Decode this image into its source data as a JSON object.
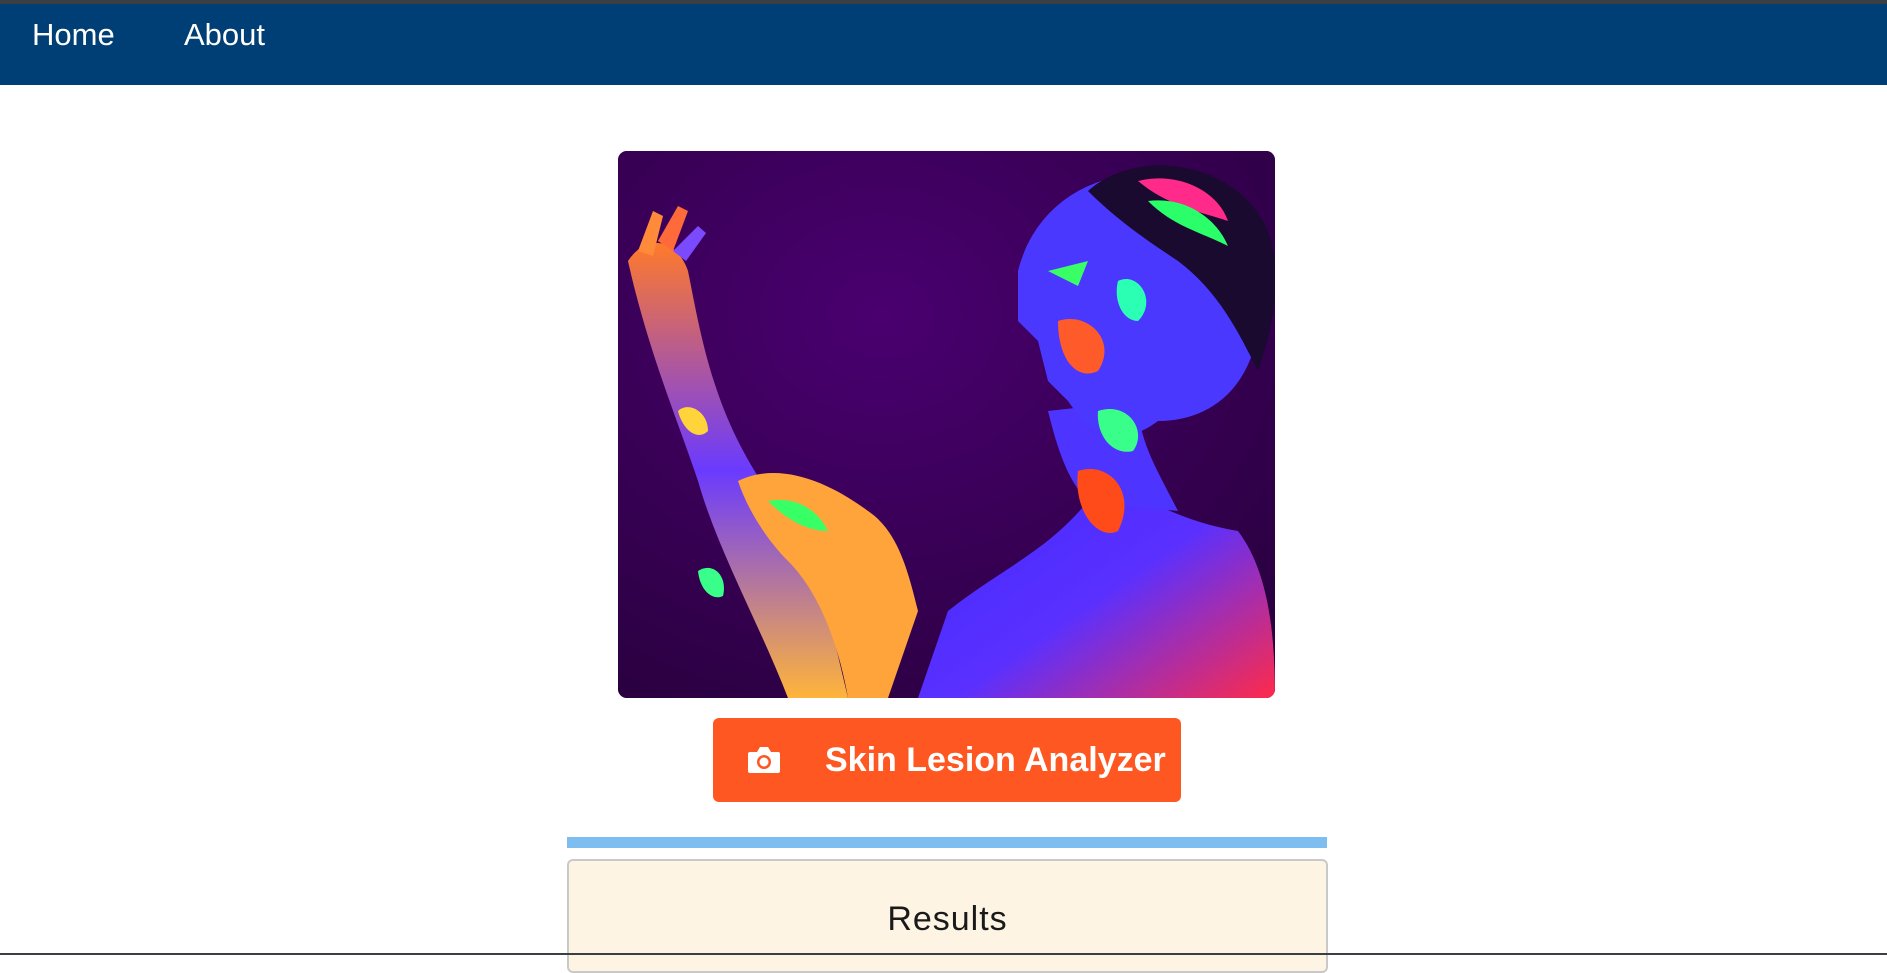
{
  "nav": {
    "items": [
      {
        "label": "Home"
      },
      {
        "label": "About"
      }
    ]
  },
  "hero": {
    "alt": "Woman with neon UV body paint"
  },
  "analyzer_button": {
    "label": "Skin Lesion Analyzer",
    "icon": "camera-icon"
  },
  "results": {
    "title": "Results"
  },
  "colors": {
    "navbar": "#003f75",
    "button": "#ff5722",
    "progress": "#7dbdf0",
    "results_bg": "#fdf4e4"
  }
}
